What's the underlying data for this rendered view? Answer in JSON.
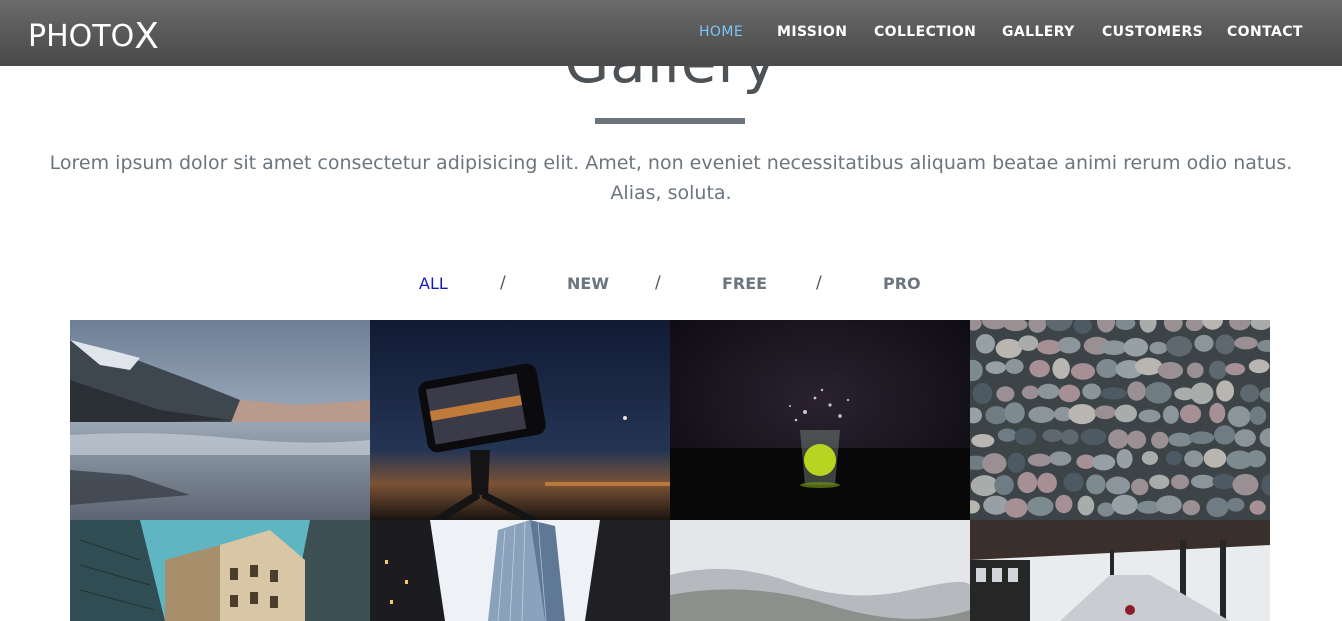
{
  "brand": {
    "logo_main": "PHOTO",
    "logo_x": "X"
  },
  "nav": {
    "items": [
      {
        "label": "HOME",
        "active": true
      },
      {
        "label": "MISSION",
        "active": false
      },
      {
        "label": "COLLECTION",
        "active": false
      },
      {
        "label": "GALLERY",
        "active": false
      },
      {
        "label": "CUSTOMERS",
        "active": false
      },
      {
        "label": "CONTACT",
        "active": false
      }
    ]
  },
  "section": {
    "title": "Gallery",
    "intro": "Lorem ipsum dolor sit amet consectetur adipisicing elit. Amet, non eveniet necessitatibus aliquam beatae animi rerum odio natus. Alias, soluta."
  },
  "filters": {
    "items": [
      {
        "label": "ALL",
        "active": true
      },
      {
        "label": "NEW",
        "active": false
      },
      {
        "label": "FREE",
        "active": false
      },
      {
        "label": "PRO",
        "active": false
      }
    ],
    "separator": "/"
  },
  "gallery": {
    "photos": [
      {
        "subject": "snowy mountain lake"
      },
      {
        "subject": "smartphone on tripod at dusk"
      },
      {
        "subject": "lime splash in glass"
      },
      {
        "subject": "pebble stones"
      },
      {
        "subject": "ornate building corner"
      },
      {
        "subject": "glass skyscraper in fog"
      },
      {
        "subject": "misty hills"
      },
      {
        "subject": "winter train station"
      }
    ]
  },
  "colors": {
    "nav_active": "#7ec4f5",
    "filter_active": "#1a1aba",
    "text_muted": "#6c757d"
  }
}
